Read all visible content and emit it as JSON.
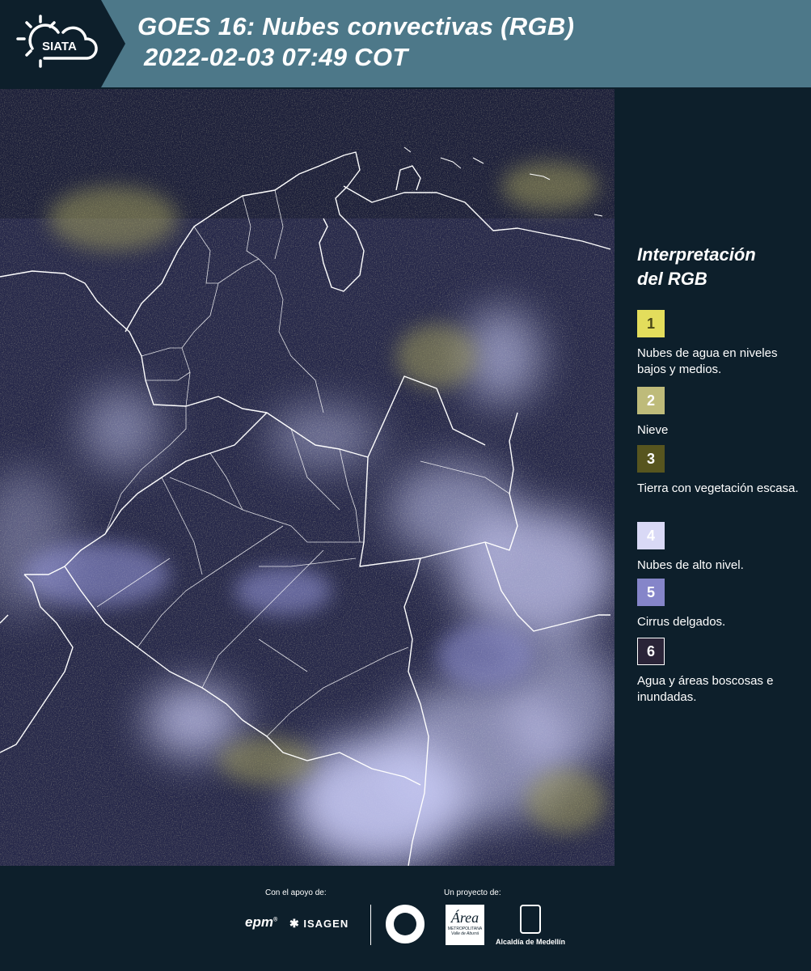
{
  "header": {
    "logo_text": "SIATA",
    "title_line1": "GOES 16: Nubes convectivas (RGB)",
    "title_line2": "2022-02-03 07:49 COT"
  },
  "legend": {
    "title_line1": "Interpretación",
    "title_line2": "del RGB",
    "items": [
      {
        "number": "1",
        "color": "#e3dd5c",
        "number_color": "#4a4818",
        "label": "Nubes de agua en niveles bajos y medios."
      },
      {
        "number": "2",
        "color": "#bebb7a",
        "number_color": "#ffffff",
        "label": "Nieve"
      },
      {
        "number": "3",
        "color": "#57551f",
        "number_color": "#ffffff",
        "label": "Tierra con vegetación escasa."
      },
      {
        "number": "4",
        "color": "#d9d9f6",
        "number_color": "#ffffff",
        "label": "Nubes de alto nivel."
      },
      {
        "number": "5",
        "color": "#8585c9",
        "number_color": "#ffffff",
        "label": "Cirrus delgados."
      },
      {
        "number": "6",
        "color": "#2a2438",
        "number_color": "#ffffff",
        "label": "Agua y áreas boscosas e inundadas."
      }
    ]
  },
  "footer": {
    "support_label": "Con el apoyo de:",
    "project_label": "Un proyecto de:",
    "epm": "epm",
    "isagen": "ISAGEN",
    "area_script": "Área",
    "area_sub1": "METROPOLITANA",
    "area_sub2": "Valle de Aburrá",
    "medellin": "Alcaldía de Medellín"
  },
  "colors": {
    "header_bg": "#4d7889",
    "page_bg": "#0d1f2b",
    "map_base": "#26284a",
    "cloud_high": "#c6c8f2",
    "cloud_low": "#b8b36a"
  }
}
